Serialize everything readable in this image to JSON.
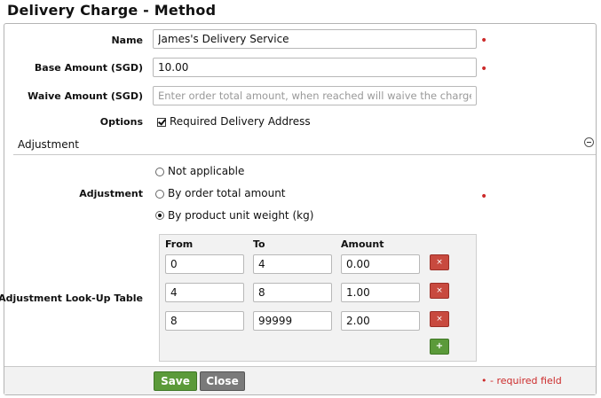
{
  "page": {
    "title": "Delivery Charge - Method"
  },
  "form": {
    "name": {
      "label": "Name",
      "value": "James's Delivery Service"
    },
    "base_amount": {
      "label": "Base Amount (SGD)",
      "value": "10.00"
    },
    "waive_amount": {
      "label": "Waive Amount (SGD)",
      "value": "",
      "placeholder": "Enter order total amount, when reached will waive the charge."
    },
    "options": {
      "label": "Options",
      "required_address_label": "Required Delivery Address",
      "required_address_checked": true
    },
    "required_marker": "•"
  },
  "adjustment_section": {
    "title": "Adjustment",
    "collapse_icon": "minus-circle-icon",
    "adjustment": {
      "label": "Adjustment",
      "options": [
        "Not applicable",
        "By order total amount",
        "By product unit weight (kg)"
      ],
      "selected": "By product unit weight (kg)"
    },
    "lookup": {
      "label": "Adjustment Look-Up Table",
      "columns": [
        "From",
        "To",
        "Amount"
      ],
      "rows": [
        {
          "from": "0",
          "to": "4",
          "amount": "0.00",
          "delete": "×"
        },
        {
          "from": "4",
          "to": "8",
          "amount": "1.00",
          "delete": "×"
        },
        {
          "from": "8",
          "to": "99999",
          "amount": "2.00",
          "delete": "×"
        }
      ],
      "add": "+"
    }
  },
  "footer": {
    "save": "Save",
    "close": "Close",
    "required_legend": "• - required field"
  },
  "colors": {
    "required": "#cc2a2a",
    "save_button": "#5b9a3a",
    "delete_button": "#c84a3f",
    "close_button": "#7a7a7a"
  }
}
